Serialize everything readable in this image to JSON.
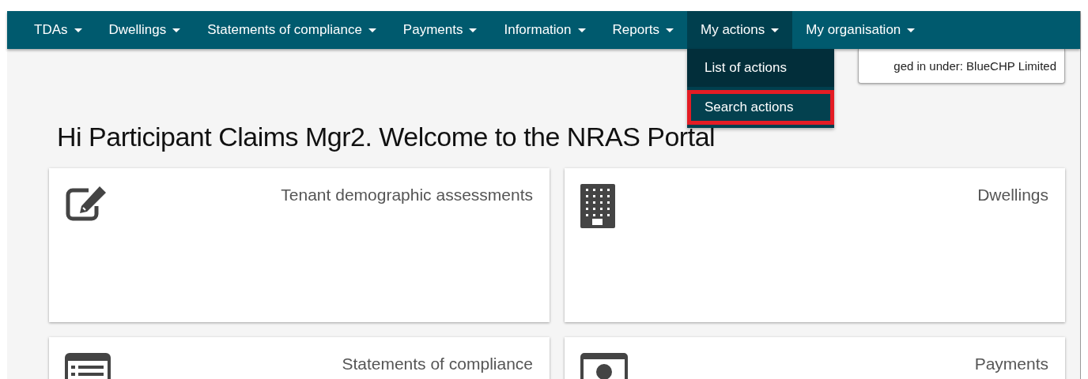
{
  "nav": {
    "items": [
      {
        "label": "TDAs",
        "selected": false
      },
      {
        "label": "Dwellings",
        "selected": false
      },
      {
        "label": "Statements of compliance",
        "selected": false
      },
      {
        "label": "Payments",
        "selected": false
      },
      {
        "label": "Information",
        "selected": false
      },
      {
        "label": "Reports",
        "selected": false
      },
      {
        "label": "My actions",
        "selected": true,
        "expanded": true,
        "menu": [
          {
            "label": "List of actions",
            "highlighted": false
          },
          {
            "label": "Search actions",
            "highlighted": true
          }
        ]
      },
      {
        "label": "My organisation",
        "selected": false
      }
    ]
  },
  "logged_in": "ged in under: BlueCHP Limited",
  "heading": "Hi Participant Claims Mgr2. Welcome to the NRAS Portal",
  "cards": [
    {
      "kind": "edit",
      "title": "Tenant demographic assessments"
    },
    {
      "kind": "building",
      "title": "Dwellings"
    },
    {
      "kind": "list",
      "title": "Statements of compliance"
    },
    {
      "kind": "money",
      "title": "Payments"
    }
  ]
}
